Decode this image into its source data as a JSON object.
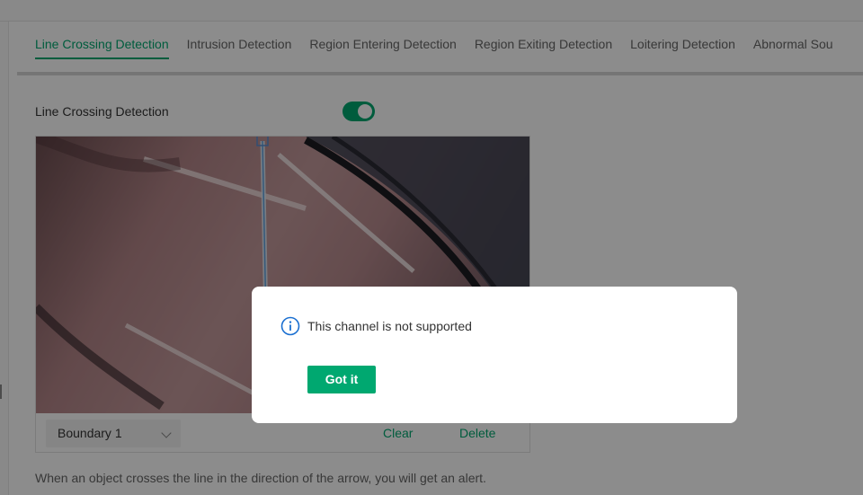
{
  "tabs": [
    {
      "label": "Line Crossing Detection",
      "active": true
    },
    {
      "label": "Intrusion Detection",
      "active": false
    },
    {
      "label": "Region Entering Detection",
      "active": false
    },
    {
      "label": "Region Exiting Detection",
      "active": false
    },
    {
      "label": "Loitering Detection",
      "active": false
    },
    {
      "label": "Abnormal Sou",
      "active": false
    }
  ],
  "setting": {
    "label": "Line Crossing Detection",
    "enabled": true
  },
  "controls": {
    "boundary_selected": "Boundary 1",
    "clear_label": "Clear",
    "delete_label": "Delete"
  },
  "hint": "When an object crosses the line in the direction of the arrow, you will get an alert.",
  "modal": {
    "message": "This channel is not supported",
    "button_label": "Got it",
    "icon": "info-icon"
  },
  "colors": {
    "accent": "#00a870",
    "info": "#1a6fd1"
  }
}
